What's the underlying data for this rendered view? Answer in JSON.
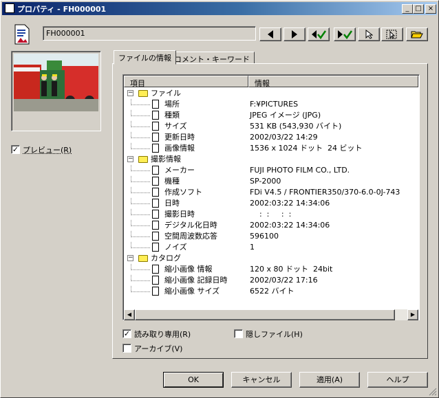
{
  "window": {
    "title": "プロパティ - FH000001"
  },
  "caption_buttons": {
    "minimize": "_",
    "maximize": "□",
    "close": "×"
  },
  "file": {
    "name": "FH000001"
  },
  "toolbar": {
    "buttons": [
      {
        "icon": "triangle-left-icon"
      },
      {
        "icon": "triangle-right-icon"
      },
      {
        "icon": "back-check-icon"
      },
      {
        "icon": "forward-check-icon"
      },
      {
        "icon": "cursor-icon"
      },
      {
        "icon": "select-cursor-icon"
      },
      {
        "icon": "open-folder-icon"
      }
    ]
  },
  "preview": {
    "checkbox_label": "プレビュー(R)",
    "checked": true
  },
  "tabs": [
    {
      "label": "ファイルの情報",
      "active": true
    },
    {
      "label": "コメント・キーワード",
      "active": false
    }
  ],
  "table": {
    "columns": [
      "項目",
      "情報"
    ],
    "groups": [
      {
        "label": "ファイル",
        "rows": [
          {
            "key": "場所",
            "value": "F:¥PICTURES"
          },
          {
            "key": "種類",
            "value": "JPEG イメージ (JPG)"
          },
          {
            "key": "サイズ",
            "value": "531 KB (543,930 バイト)"
          },
          {
            "key": "更新日時",
            "value": "2002/03/22 14:29"
          },
          {
            "key": "画像情報",
            "value": "1536 x 1024 ドット  24 ビット"
          }
        ]
      },
      {
        "label": "撮影情報",
        "rows": [
          {
            "key": "メーカー",
            "value": "FUJI PHOTO FILM CO., LTD."
          },
          {
            "key": "機種",
            "value": "SP-2000"
          },
          {
            "key": "作成ソフト",
            "value": "FDi V4.5 / FRONTIER350/370-6.0-0J-743"
          },
          {
            "key": "日時",
            "value": "2002:03:22 14:34:06"
          },
          {
            "key": "撮影日時",
            "value": "    :  :     :  :"
          },
          {
            "key": "デジタル化日時",
            "value": "2002:03:22 14:34:06"
          },
          {
            "key": "空間周波数応答",
            "value": "596100"
          },
          {
            "key": "ノイズ",
            "value": "1"
          }
        ]
      },
      {
        "label": "カタログ",
        "rows": [
          {
            "key": "縮小画像 情報",
            "value": "120 x 80 ドット  24bit"
          },
          {
            "key": "縮小画像 記録日時",
            "value": "2002/03/22 17:16"
          },
          {
            "key": "縮小画像 サイズ",
            "value": "6522 バイト"
          }
        ]
      }
    ]
  },
  "scrollbar": {
    "left_arrow": "◀",
    "right_arrow": "▶"
  },
  "options": {
    "readonly": {
      "label": "読み取り専用(R)",
      "checked": true
    },
    "hidden": {
      "label": "隠しファイル(H)",
      "checked": false
    },
    "archive": {
      "label": "アーカイブ(V)",
      "checked": false
    }
  },
  "buttons": {
    "ok": "OK",
    "cancel": "キャンセル",
    "apply": "適用(A)",
    "help": "ヘルプ"
  }
}
